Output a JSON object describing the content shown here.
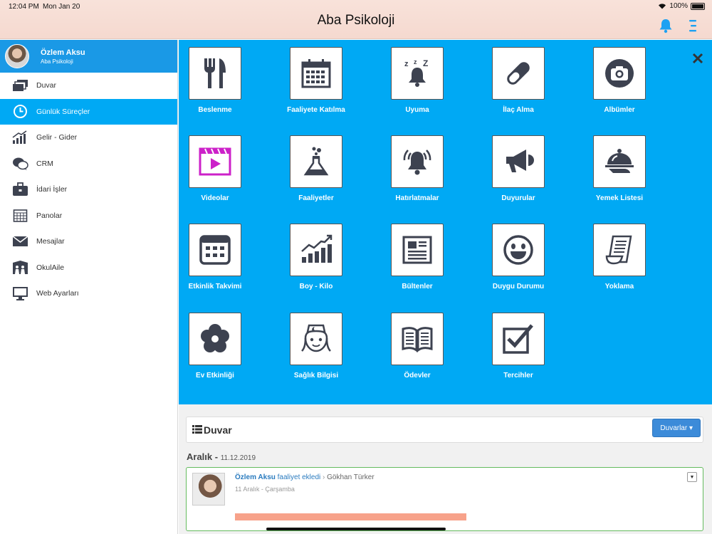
{
  "status": {
    "time": "12:04 PM",
    "date": "Mon Jan 20",
    "battery": "100%"
  },
  "header": {
    "title": "Aba Psikoloji"
  },
  "profile": {
    "name": "Özlem Aksu",
    "subtitle": "Aba Psikoloji"
  },
  "sidebar": {
    "items": [
      {
        "label": "Duvar",
        "icon": "stack-icon"
      },
      {
        "label": "Günlük Süreçler",
        "icon": "clock-icon"
      },
      {
        "label": "Gelir - Gider",
        "icon": "growth-chart-icon"
      },
      {
        "label": "CRM",
        "icon": "chat-bubbles-icon"
      },
      {
        "label": "İdari İşler",
        "icon": "briefcase-icon"
      },
      {
        "label": "Panolar",
        "icon": "calendar-board-icon"
      },
      {
        "label": "Mesajlar",
        "icon": "envelope-icon"
      },
      {
        "label": "OkulAile",
        "icon": "family-icon"
      },
      {
        "label": "Web Ayarları",
        "icon": "monitor-icon"
      }
    ]
  },
  "tiles": [
    {
      "label": "Beslenme",
      "icon": "utensils-icon"
    },
    {
      "label": "Faaliyete Katılma",
      "icon": "calendar-icon"
    },
    {
      "label": "Uyuma",
      "icon": "sleep-bell-icon"
    },
    {
      "label": "İlaç Alma",
      "icon": "pill-icon"
    },
    {
      "label": "Albümler",
      "icon": "camera-icon"
    },
    {
      "label": "Videolar",
      "icon": "video-icon"
    },
    {
      "label": "Faaliyetler",
      "icon": "flask-icon"
    },
    {
      "label": "Hatırlatmalar",
      "icon": "alarm-bell-icon"
    },
    {
      "label": "Duyurular",
      "icon": "megaphone-icon"
    },
    {
      "label": "Yemek Listesi",
      "icon": "cloche-icon"
    },
    {
      "label": "Etkinlik Takvimi",
      "icon": "event-calendar-icon"
    },
    {
      "label": "Boy - Kilo",
      "icon": "growth-icon"
    },
    {
      "label": "Bültenler",
      "icon": "newsletter-icon"
    },
    {
      "label": "Duygu Durumu",
      "icon": "smiley-icon"
    },
    {
      "label": "Yoklama",
      "icon": "scroll-icon"
    },
    {
      "label": "Ev Etkinliği",
      "icon": "flower-icon"
    },
    {
      "label": "Sağlık Bilgisi",
      "icon": "nurse-icon"
    },
    {
      "label": "Ödevler",
      "icon": "book-icon"
    },
    {
      "label": "Tercihler",
      "icon": "checkbox-icon"
    }
  ],
  "wall": {
    "title": "Duvar",
    "walls_button": "Duvarlar ▾",
    "section_month": "Aralık -",
    "section_date": "11.12.2019",
    "post": {
      "author": "Özlem Aksu",
      "verb": "faaliyet ekledi",
      "target": "Gökhan Türker",
      "meta": "11 Aralık - Çarşamba",
      "menu": "▼"
    }
  },
  "colors": {
    "accent": "#00a9f4",
    "profile_bar": "#1a99e6",
    "icon": "#3d4250",
    "video": "#cc21c9"
  }
}
